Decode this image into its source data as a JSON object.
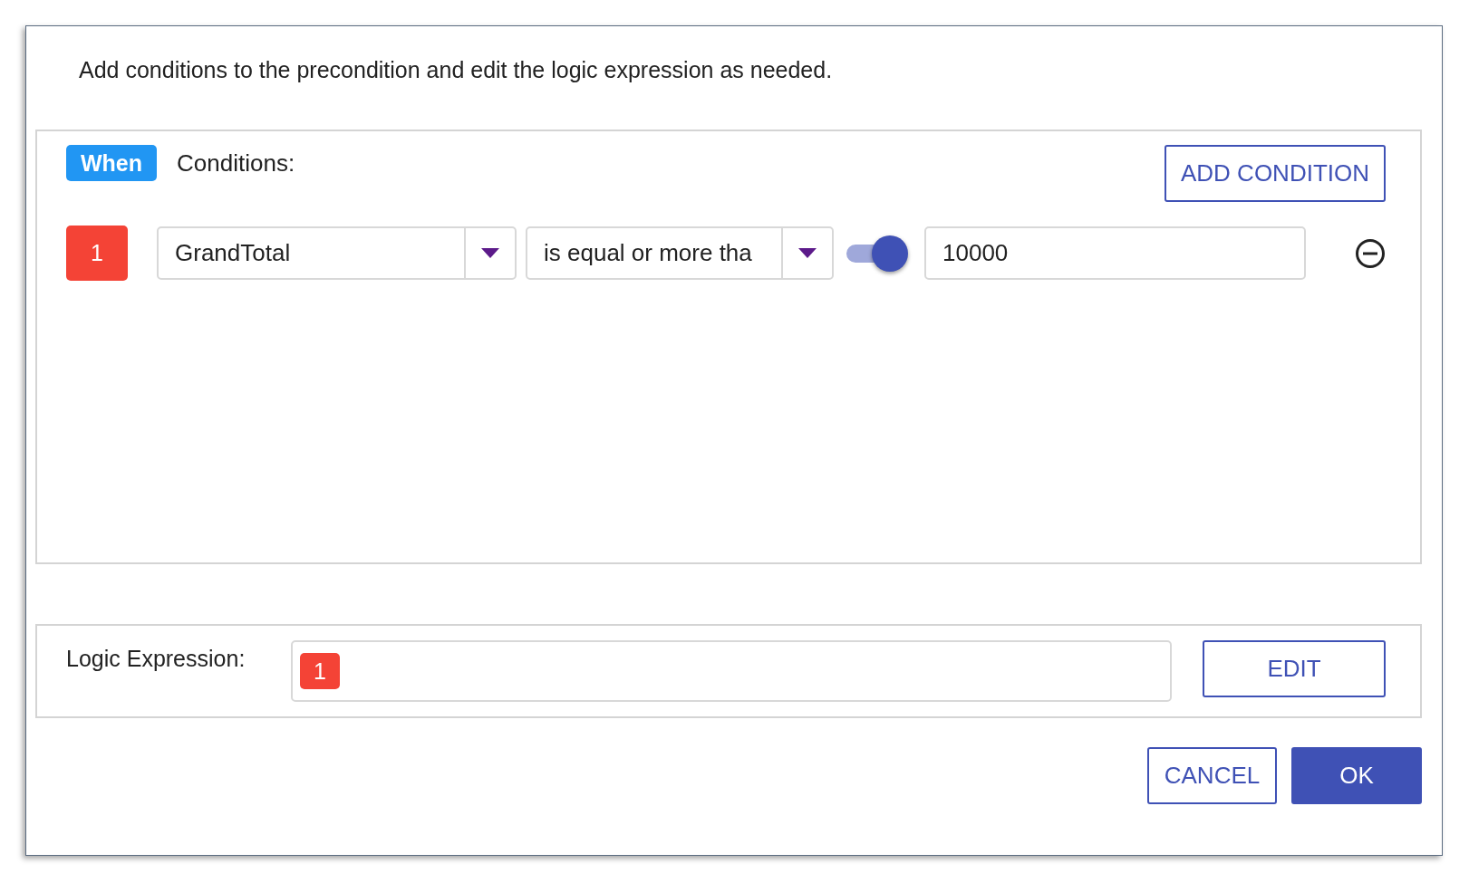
{
  "description": "Add conditions to the precondition and edit the logic expression as needed.",
  "conditions_panel": {
    "when_label": "When",
    "label": "Conditions:",
    "add_button": "ADD CONDITION",
    "conditions": [
      {
        "index": "1",
        "field": "GrandTotal",
        "operator": "is equal or more tha",
        "toggle_on": true,
        "value": "10000"
      }
    ]
  },
  "logic": {
    "label": "Logic Expression:",
    "tokens": [
      "1"
    ],
    "edit_button": "EDIT"
  },
  "buttons": [
    {
      "label": "CANCEL",
      "kind": "secondary"
    },
    {
      "label": "OK",
      "kind": "primary"
    }
  ]
}
